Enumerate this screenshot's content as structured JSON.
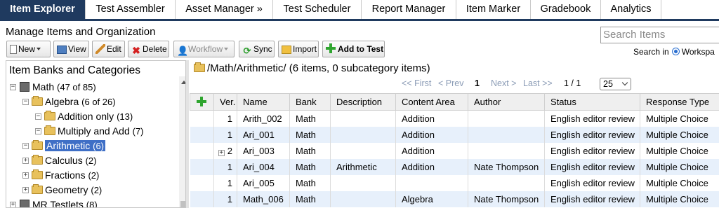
{
  "tabs": [
    {
      "label": "Item Explorer",
      "active": true
    },
    {
      "label": "Test Assembler"
    },
    {
      "label": "Asset Manager »"
    },
    {
      "label": "Test Scheduler"
    },
    {
      "label": "Report Manager"
    },
    {
      "label": "Item Marker"
    },
    {
      "label": "Gradebook"
    },
    {
      "label": "Analytics"
    }
  ],
  "header": {
    "title": "Manage Items and Organization",
    "search_placeholder": "Search Items",
    "search_in_label": "Search in",
    "search_scope": "Workspa"
  },
  "toolbar": {
    "new_label": "New",
    "view_label": "View",
    "edit_label": "Edit",
    "delete_label": "Delete",
    "workflow_label": "Workflow",
    "sync_label": "Sync",
    "import_label": "Import",
    "add_to_test_label": "Add to Test"
  },
  "left_panel": {
    "title": "Item Banks and Categories",
    "tree": [
      {
        "label": "Math",
        "count": "(47 of 85)"
      },
      {
        "label": "Algebra",
        "count": "(6 of 26)"
      },
      {
        "label": "Addition only",
        "count": "(13)"
      },
      {
        "label": "Multiply and Add",
        "count": "(7)"
      },
      {
        "label": "Arithmetic",
        "count": "(6)"
      },
      {
        "label": "Calculus",
        "count": "(2)"
      },
      {
        "label": "Fractions",
        "count": "(2)"
      },
      {
        "label": "Geometry",
        "count": "(2)"
      },
      {
        "label": "MR Testlets",
        "count": "(8)"
      }
    ]
  },
  "main": {
    "path": "/Math/Arithmetic/ (6 items, 0 subcategory items)",
    "pager": {
      "first": "<< First",
      "prev": "< Prev",
      "current": "1",
      "next": "Next >",
      "last": "Last >>",
      "count": "1 / 1",
      "page_size": "25"
    },
    "columns": [
      "Ver.",
      "Name",
      "Bank",
      "Description",
      "Content Area",
      "Author",
      "Status",
      "Response Type"
    ],
    "rows": [
      {
        "ver": "1",
        "name": "Arith_002",
        "bank": "Math",
        "description": "",
        "content_area": "Addition",
        "author": "",
        "status": "English editor review",
        "response_type": "Multiple Choice"
      },
      {
        "ver": "1",
        "name": "Ari_001",
        "bank": "Math",
        "description": "",
        "content_area": "Addition",
        "author": "",
        "status": "English editor review",
        "response_type": "Multiple Choice"
      },
      {
        "ver": "2",
        "name": "Ari_003",
        "bank": "Math",
        "description": "",
        "content_area": "Addition",
        "author": "",
        "status": "English editor review",
        "response_type": "Multiple Choice"
      },
      {
        "ver": "1",
        "name": "Ari_004",
        "bank": "Math",
        "description": "Arithmetic",
        "content_area": "Addition",
        "author": "Nate Thompson",
        "status": "English editor review",
        "response_type": "Multiple Choice"
      },
      {
        "ver": "1",
        "name": "Ari_005",
        "bank": "Math",
        "description": "",
        "content_area": "",
        "author": "",
        "status": "English editor review",
        "response_type": "Multiple Choice"
      },
      {
        "ver": "1",
        "name": "Math_006",
        "bank": "Math",
        "description": "",
        "content_area": "Algebra",
        "author": "Nate Thompson",
        "status": "English editor review",
        "response_type": "Multiple Choice"
      }
    ]
  },
  "colors": {
    "tab_active": "#1f3a5f",
    "selection": "#3f6fc6",
    "row_alt": "#e7f0fb",
    "add_green": "#2fa52f"
  }
}
